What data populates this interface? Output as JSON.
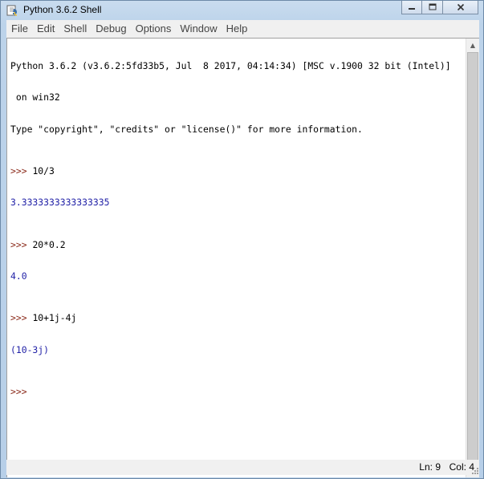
{
  "window": {
    "title": "Python 3.6.2 Shell",
    "icon": "python-idle-icon",
    "caption_buttons": {
      "minimize": "minimize-icon",
      "maximize": "maximize-icon",
      "close": "close-icon"
    }
  },
  "menu": {
    "items": [
      "File",
      "Edit",
      "Shell",
      "Debug",
      "Options",
      "Window",
      "Help"
    ]
  },
  "shell": {
    "banner": [
      "Python 3.6.2 (v3.6.2:5fd33b5, Jul  8 2017, 04:14:34) [MSC v.1900 32 bit (Intel)]",
      " on win32",
      "Type \"copyright\", \"credits\" or \"license()\" for more information."
    ],
    "prompt": ">>> ",
    "entries": [
      {
        "input": "10/3",
        "output": "3.3333333333333335"
      },
      {
        "input": "20*0.2",
        "output": "4.0"
      },
      {
        "input": "10+1j-4j",
        "output": "(10-3j)"
      }
    ],
    "final_prompt": ">>>"
  },
  "status": {
    "ln": "Ln: 9",
    "col": "Col: 4"
  },
  "colors": {
    "prompt": "#8b2a1a",
    "output": "#1f1fa6",
    "input": "#000000"
  }
}
